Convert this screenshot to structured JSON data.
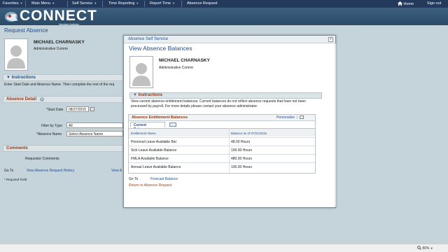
{
  "nav": {
    "favorites": "Favorites",
    "main_menu": "Main Menu",
    "self_service": "Self Service",
    "time_reporting": "Time Reporting",
    "report_time": "Report Time",
    "absence_request": "Absence Request",
    "home": "Home",
    "signout": "Sign out"
  },
  "logo": {
    "text": "CONNECT",
    "sub": "Maryland Judiciary"
  },
  "page": {
    "title": "Request Absence",
    "employee_name": "MICHAEL CHARNASKY",
    "employee_title": "Administrative Commr",
    "instructions_label": "Instructions",
    "instructions_text": "Enter Start Date and Absence Name. Then complete the rest of the req",
    "absence_detail_label": "Absence Detail",
    "start_date_label": "*Start Date",
    "start_date_value": "08/27/2015",
    "filter_label": "Filter by Type",
    "filter_value": "All",
    "absence_name_label": "*Absence Name",
    "absence_name_value": "Select Absence Name",
    "comments_label": "Comments",
    "requestor_comments_label": "Requestor Comments",
    "goto_label": "Go To",
    "history_link": "View Absence Request History",
    "view_link": "View A",
    "required_note": "* Required Field"
  },
  "modal": {
    "header": "Absence Self Service",
    "close": "x",
    "title": "View Absence Balances",
    "employee_name": "MICHAEL CHARNASKY",
    "employee_title": "Administrative Commr",
    "instructions_label": "Instructions",
    "instructions_text": "View current absence entitlement balances. Current balances do not reflect absence requests that have not been processed by payroll. For more details please contact your absence administrator.",
    "grid_title": "Absence Entitlement Balances",
    "personalize": "Personalize",
    "tab": "Current Balances",
    "columns": [
      "Entitlement Name",
      "Balance as of 07/21/2015"
    ],
    "rows": [
      [
        "Personal Leave Available Bal",
        "48.00 Hours"
      ],
      [
        "Sick Leave Available Balance",
        "100.00 Hours"
      ],
      [
        "FMLA Available Balance",
        "480.00 Hours"
      ],
      [
        "Annual Leave Available Balance",
        "100.00 Hours"
      ]
    ],
    "goto_label": "Go To",
    "forecast_link": "Forecast Balance",
    "return_link": "Return to Absence Request"
  },
  "status": {
    "zoom": "80%"
  }
}
